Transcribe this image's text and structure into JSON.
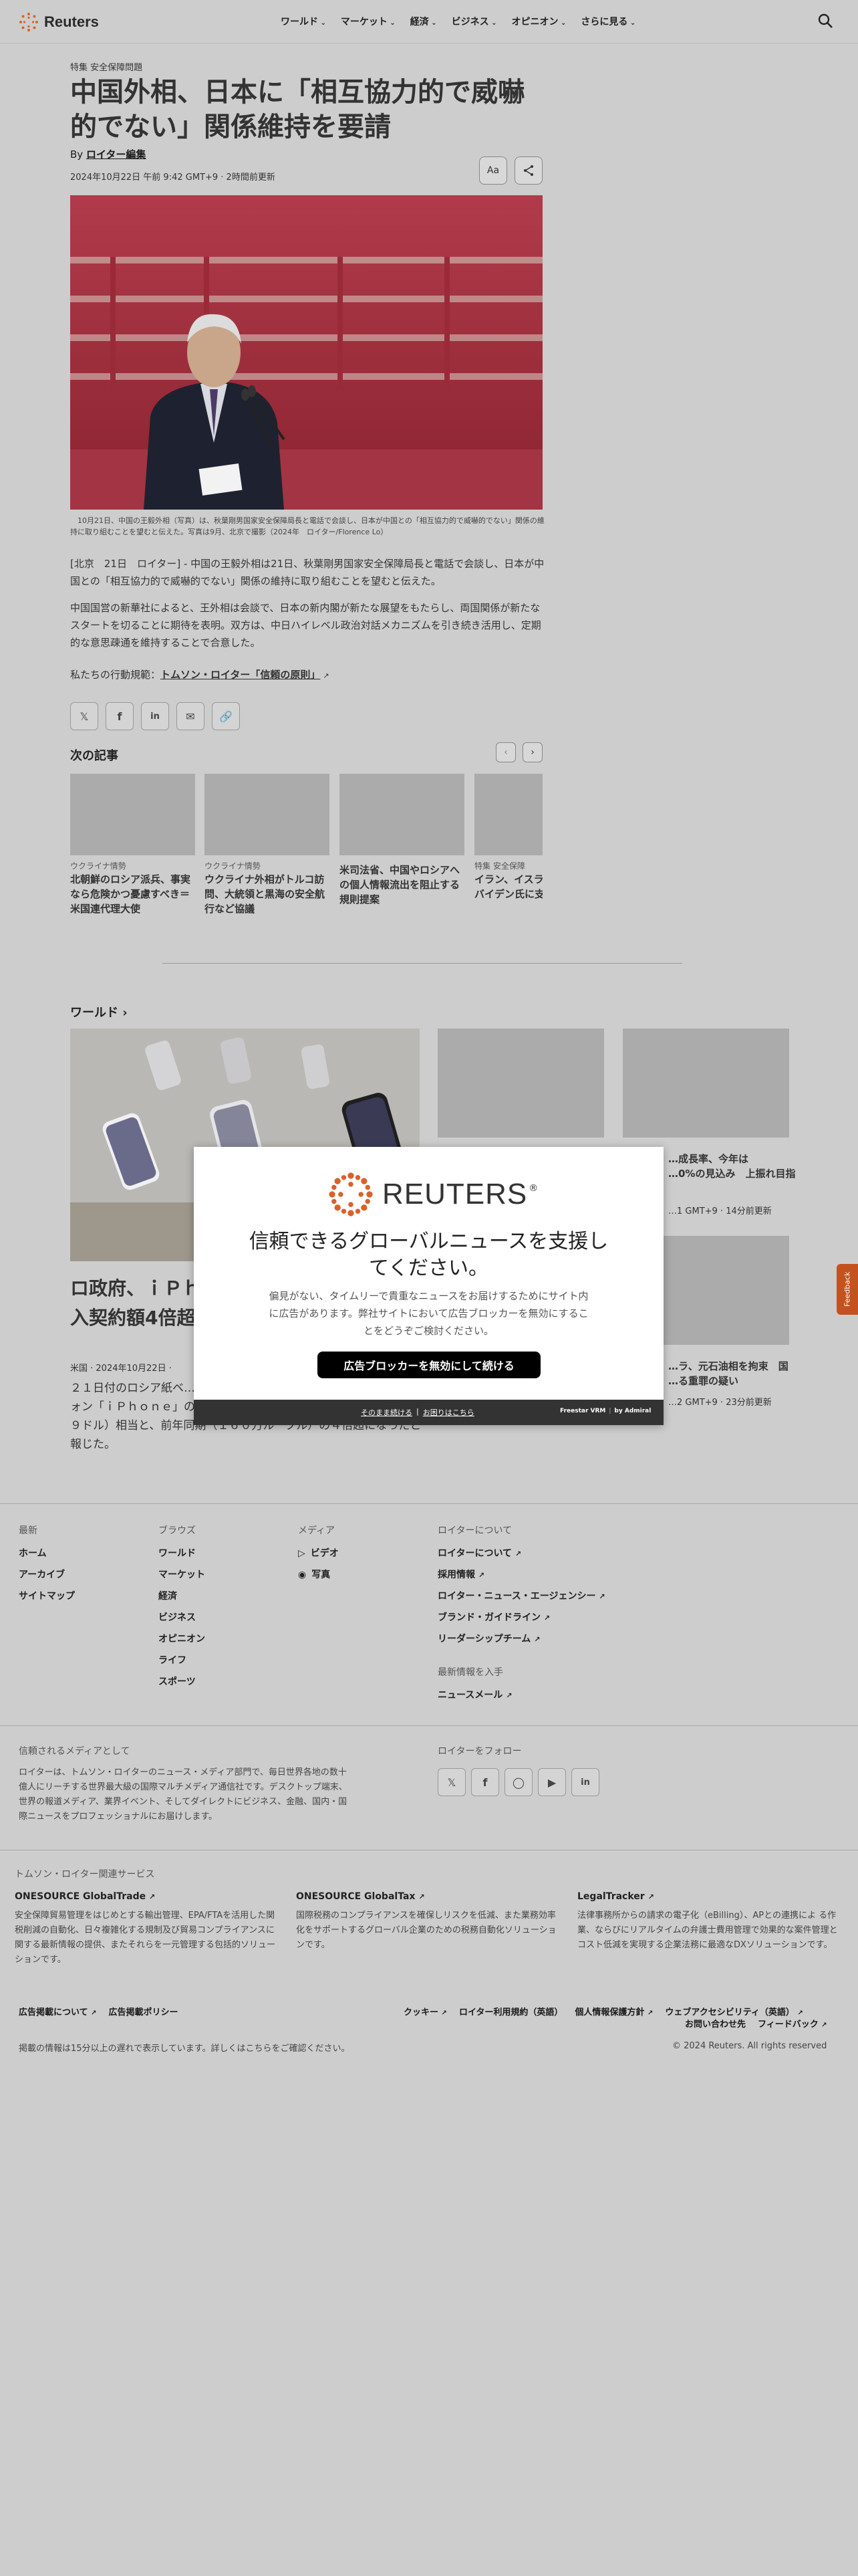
{
  "header": {
    "logo_text": "Reuters",
    "nav": [
      "ワールド",
      "マーケット",
      "経済",
      "ビジネス",
      "オピニオン",
      "さらに見る"
    ]
  },
  "article": {
    "topics": "特集 安全保障問題",
    "title_line1": "中国外相、日本に「相互協力的で威嚇",
    "title_line2": "的でない」関係維持を要請",
    "by": "By",
    "author": "ロイター編集",
    "date": "2024年10月22日 午前 9:42 GMT+9 · 2時間前更新",
    "font_btn": "Aa",
    "caption": "　10月21日、中国の王毅外相（写真）は、秋葉剛男国家安全保障局長と電話で会談し、日本が中国との「相互協力的で威嚇的でない」関係の維持に取り組むことを望むと伝えた。写真は9月、北京で撮影（2024年　ロイター/Florence Lo）",
    "para1": "[北京　21日　ロイター] - 中国の王毅外相は21日、秋葉剛男国家安全保障局長と電話で会談し、日本が中国との「相互協力的で威嚇的でない」関係の維持に取り組むことを望むと伝えた。",
    "para2": "中国国営の新華社によると、王外相は会談で、日本の新内閣が新たな展望をもたらし、両国関係が新たなスタートを切ることに期待を表明。双方は、中日ハイレベル政治対話メカニズムを引き続き活用し、定期的な意思疎通を維持することで合意した。",
    "principles_prefix": "私たちの行動規範：",
    "principles_link": "トムソン・ロイター「信頼の原則」"
  },
  "next_articles": {
    "heading": "次の記事",
    "cards": [
      {
        "topic": "ウクライナ情勢",
        "title": "北朝鮮のロシア派兵、事実なら危険かつ憂慮すべき＝米国連代理大使"
      },
      {
        "topic": "ウクライナ情勢",
        "title": "ウクライナ外相がトルコ訪問、大統領と黒海の安全航行など協議"
      },
      {
        "topic": "",
        "title": "米司法省、中国やロシアへの個人情報流出を阻止する規則提案"
      },
      {
        "topic": "特集 安全保障",
        "title": "イラン、イスラエル攻撃をバイデン氏に支持と非難"
      }
    ]
  },
  "world": {
    "heading": "ワールド",
    "lead_title_1": "ロ政府、ｉＰｈ",
    "lead_title_2": "入契約額4倍超",
    "lead_meta": "米国 · 2024年10月22日 ·",
    "lead_body": "２１日付のロシア紙ベ…９月に購入契約した米アップルのスマートフォン「ｉＰｈｏｎｅ」の総額は１億４７００万ルーブル（７万１４６９ドル）相当と、前年同期（１６０万ルーブル）の４倍超になったと報じた。",
    "right1_title_1": "…成長率、今年は",
    "right1_title_2": "…0%の見込み　上振れ目指",
    "right1_meta": "…1 GMT+9 · 14分前更新",
    "right2_title_1": "…ラ、元石油相を拘束　国",
    "right2_title_2": "…る重罪の疑い",
    "right2_meta": "…2 GMT+9 · 23分前更新"
  },
  "modal": {
    "brand": "REUTERS",
    "headline_1": "信頼できるグローバルニュースを支援し",
    "headline_2": "てください。",
    "body_1": "偏見がない、タイムリーで貴重なニュースをお届けするためにサイト内",
    "body_2": "に広告があります。弊社サイトにおいて広告ブロッカーを無効にするこ",
    "body_3": "とをどうぞご検討ください。",
    "button": "広告ブロッカーを無効にして続ける",
    "continue": "そのまま続ける",
    "sep": "|",
    "help": "お困りはこちら",
    "powered": "Freestar VRM",
    "by": "by Admiral"
  },
  "footer": {
    "latest": {
      "heading": "最新",
      "links": [
        "ホーム",
        "アーカイブ",
        "サイトマップ"
      ]
    },
    "browse": {
      "heading": "ブラウズ",
      "links": [
        "ワールド",
        "マーケット",
        "経済",
        "ビジネス",
        "オピニオン",
        "ライフ",
        "スポーツ"
      ]
    },
    "media": {
      "heading": "メディア",
      "links": [
        "ビデオ",
        "写真"
      ]
    },
    "about": {
      "heading": "ロイターについて",
      "links": [
        "ロイターについて",
        "採用情報",
        "ロイター・ニュース・エージェンシー",
        "ブランド・ガイドライン",
        "リーダーシップチーム"
      ]
    },
    "stay": {
      "heading": "最新情報を入手",
      "link": "ニュースメール"
    },
    "trusted_heading": "信頼されるメディアとして",
    "trusted_body": "ロイターは、トムソン・ロイターのニュース・メディア部門で、毎日世界各地の数十億人にリーチする世界最大級の国際マルチメディア通信社です。デスクトップ端末、世界の報道メディア、業界イベント、そしてダイレクトにビジネス、金融、国内・国際ニュースをプロフェッショナルにお届けします。",
    "follow_heading": "ロイターをフォロー",
    "services_heading": "トムソン・ロイター関連サービス",
    "services": [
      {
        "name": "ONESOURCE GlobalTrade",
        "desc": "安全保障貿易管理をはじめとする輸出管理、EPA/FTAを活用した関税削減の自動化、日々複雑化する規制及び貿易コンプライアンスに関する最新情報の提供、またそれらを一元管理する包括的ソリューションです。"
      },
      {
        "name": "ONESOURCE GlobalTax",
        "desc": "国際税務のコンプライアンスを確保しリスクを低減、また業務効率化をサポートするグローバル企業のための税務自動化ソリューションです。"
      },
      {
        "name": "LegalTracker",
        "desc": "法律事務所からの請求の電子化（eBilling）、APとの連携によ る作業、ならびにリアルタイムの弁護士費用管理で効果的な案件管理とコスト低減を実現する企業法務に最適なDXソリューションです。"
      }
    ],
    "bottom_links_left": [
      "広告掲載について",
      "広告掲載ポリシー"
    ],
    "bottom_links_right": [
      "クッキー",
      "ロイター利用規約（英語）",
      "個人情報保護方針",
      "ウェブアクセシビリティ（英語）"
    ],
    "contact": "お問い合わせ先",
    "feedback_link": "フィードバック",
    "disclaimer": "掲載の情報は15分以上の遅れで表示しています。詳しくはこちらをご確認ください。",
    "copyright": "© 2024 Reuters. All rights reserved"
  },
  "feedback_tab": "Feedback"
}
